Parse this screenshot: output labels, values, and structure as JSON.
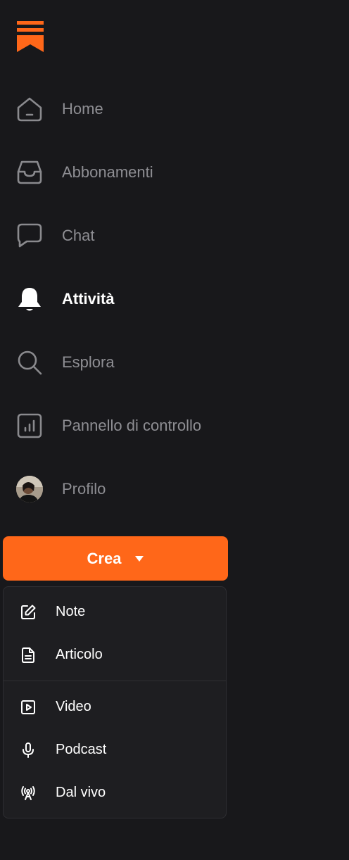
{
  "brand": {
    "logo_icon": "substack-logo-icon",
    "accent": "#ff6719"
  },
  "nav": {
    "items": [
      {
        "label": "Home",
        "icon": "home-icon"
      },
      {
        "label": "Abbonamenti",
        "icon": "inbox-icon"
      },
      {
        "label": "Chat",
        "icon": "chat-bubble-icon"
      },
      {
        "label": "Attività",
        "icon": "bell-icon",
        "active": true
      },
      {
        "label": "Esplora",
        "icon": "search-icon"
      },
      {
        "label": "Pannello di controllo",
        "icon": "dashboard-chart-icon"
      },
      {
        "label": "Profilo",
        "icon": "avatar"
      }
    ]
  },
  "create": {
    "label": "Crea",
    "menu": {
      "group1": [
        {
          "label": "Note",
          "icon": "edit-note-icon"
        },
        {
          "label": "Articolo",
          "icon": "document-icon"
        }
      ],
      "group2": [
        {
          "label": "Video",
          "icon": "video-play-icon"
        },
        {
          "label": "Podcast",
          "icon": "microphone-icon"
        },
        {
          "label": "Dal vivo",
          "icon": "live-broadcast-icon"
        }
      ]
    }
  }
}
